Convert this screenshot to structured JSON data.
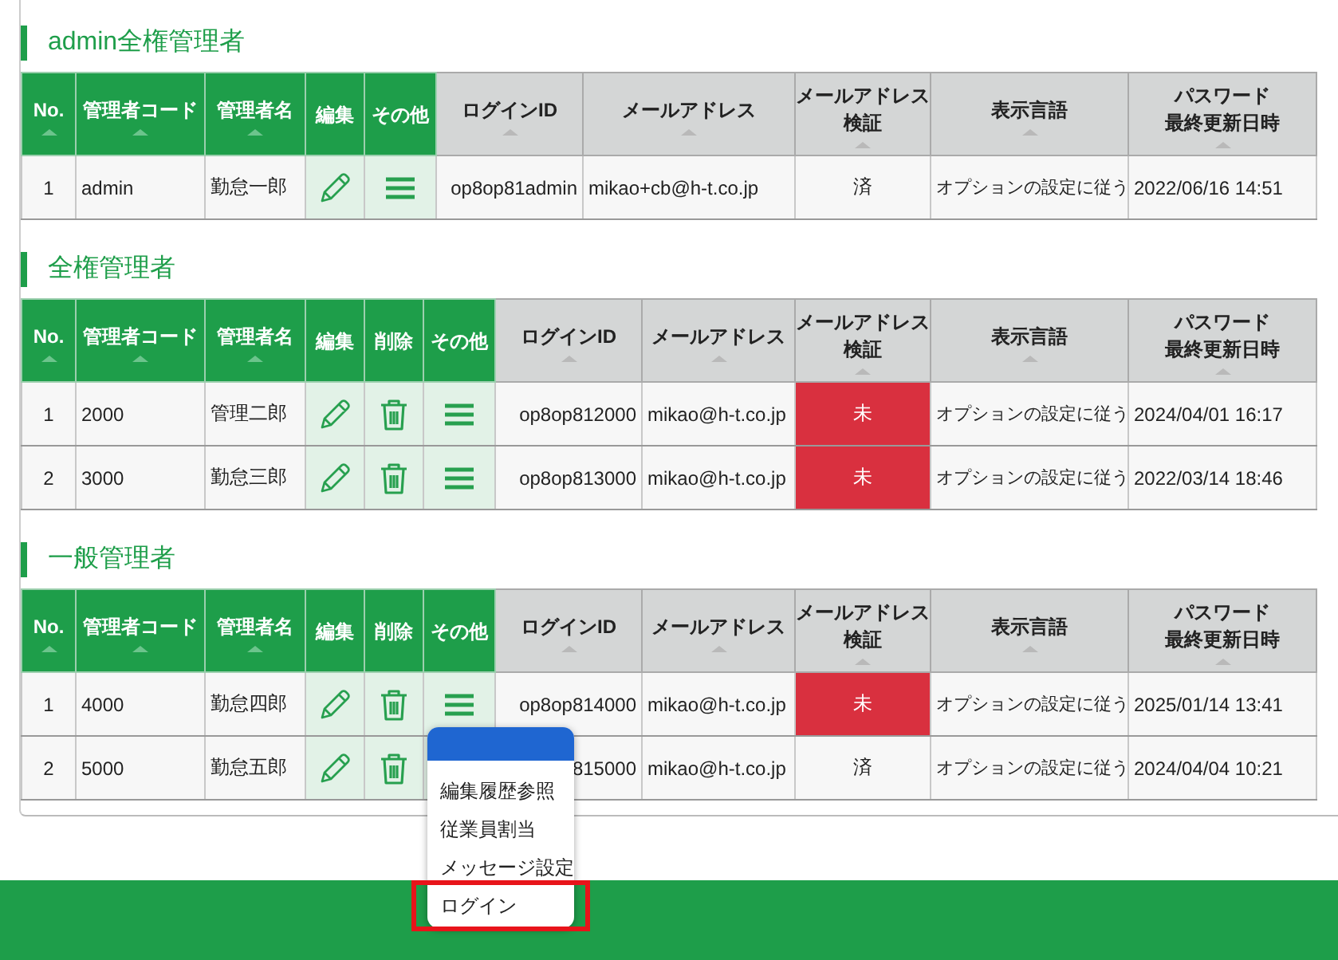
{
  "sections": [
    {
      "title": "admin全権管理者",
      "columns": [
        {
          "lines": [
            "No."
          ],
          "kind": "text",
          "sortable": true
        },
        {
          "lines": [
            "管理者コード"
          ],
          "kind": "text",
          "sortable": true
        },
        {
          "lines": [
            "管理者名"
          ],
          "kind": "text",
          "sortable": true
        },
        {
          "lines": [
            "編集"
          ],
          "kind": "edit",
          "sortable": false
        },
        {
          "lines": [
            "その他"
          ],
          "kind": "menu",
          "sortable": false
        },
        {
          "lines": [
            "ログインID"
          ],
          "kind": "text",
          "sortable": true
        },
        {
          "lines": [
            "メールアドレス"
          ],
          "kind": "text",
          "sortable": true
        },
        {
          "lines": [
            "メールアドレス",
            "検証"
          ],
          "kind": "verify",
          "sortable": true
        },
        {
          "lines": [
            "表示言語"
          ],
          "kind": "text",
          "sortable": true
        },
        {
          "lines": [
            "パスワード",
            "最終更新日時"
          ],
          "kind": "text",
          "sortable": true
        }
      ],
      "rows": [
        {
          "cells": [
            "1",
            "admin",
            "勤怠一郎",
            "",
            "",
            "op8op81admin",
            "mikao+cb@h-t.co.jp",
            "済",
            "オプションの設定に従う",
            "2022/06/16 14:51"
          ],
          "verified": true
        }
      ]
    },
    {
      "title": "全権管理者",
      "columns": [
        {
          "lines": [
            "No."
          ],
          "kind": "text",
          "sortable": true
        },
        {
          "lines": [
            "管理者コード"
          ],
          "kind": "text",
          "sortable": true
        },
        {
          "lines": [
            "管理者名"
          ],
          "kind": "text",
          "sortable": true
        },
        {
          "lines": [
            "編集"
          ],
          "kind": "edit",
          "sortable": false
        },
        {
          "lines": [
            "削除"
          ],
          "kind": "delete",
          "sortable": false
        },
        {
          "lines": [
            "その他"
          ],
          "kind": "menu",
          "sortable": false
        },
        {
          "lines": [
            "ログインID"
          ],
          "kind": "text",
          "sortable": true
        },
        {
          "lines": [
            "メールアドレス"
          ],
          "kind": "text",
          "sortable": true
        },
        {
          "lines": [
            "メールアドレス",
            "検証"
          ],
          "kind": "verify",
          "sortable": true
        },
        {
          "lines": [
            "表示言語"
          ],
          "kind": "text",
          "sortable": true
        },
        {
          "lines": [
            "パスワード",
            "最終更新日時"
          ],
          "kind": "text",
          "sortable": true
        }
      ],
      "rows": [
        {
          "cells": [
            "1",
            "2000",
            "管理二郎",
            "",
            "",
            "",
            "op8op812000",
            "mikao@h-t.co.jp",
            "未",
            "オプションの設定に従う",
            "2024/04/01 16:17"
          ],
          "verified": false
        },
        {
          "cells": [
            "2",
            "3000",
            "勤怠三郎",
            "",
            "",
            "",
            "op8op813000",
            "mikao@h-t.co.jp",
            "未",
            "オプションの設定に従う",
            "2022/03/14 18:46"
          ],
          "verified": false
        }
      ]
    },
    {
      "title": "一般管理者",
      "columns": [
        {
          "lines": [
            "No."
          ],
          "kind": "text",
          "sortable": true
        },
        {
          "lines": [
            "管理者コード"
          ],
          "kind": "text",
          "sortable": true
        },
        {
          "lines": [
            "管理者名"
          ],
          "kind": "text",
          "sortable": true
        },
        {
          "lines": [
            "編集"
          ],
          "kind": "edit",
          "sortable": false
        },
        {
          "lines": [
            "削除"
          ],
          "kind": "delete",
          "sortable": false
        },
        {
          "lines": [
            "その他"
          ],
          "kind": "menu",
          "sortable": false
        },
        {
          "lines": [
            "ログインID"
          ],
          "kind": "text",
          "sortable": true
        },
        {
          "lines": [
            "メールアドレス"
          ],
          "kind": "text",
          "sortable": true
        },
        {
          "lines": [
            "メールアドレス",
            "検証"
          ],
          "kind": "verify",
          "sortable": true
        },
        {
          "lines": [
            "表示言語"
          ],
          "kind": "text",
          "sortable": true
        },
        {
          "lines": [
            "パスワード",
            "最終更新日時"
          ],
          "kind": "text",
          "sortable": true
        }
      ],
      "rows": [
        {
          "cells": [
            "1",
            "4000",
            "勤怠四郎",
            "",
            "",
            "",
            "op8op814000",
            "mikao@h-t.co.jp",
            "未",
            "オプションの設定に従う",
            "2025/01/14 13:41"
          ],
          "verified": false,
          "menu": {
            "items": [
              {
                "label": "編集履歴参照",
                "highlighted": false
              },
              {
                "label": "従業員割当",
                "highlighted": false
              },
              {
                "label": "メッセージ設定",
                "highlighted": false
              },
              {
                "label": "ログイン",
                "highlighted": true
              }
            ]
          }
        },
        {
          "cells": [
            "2",
            "5000",
            "勤怠五郎",
            "",
            "",
            "",
            "815000",
            "mikao@h-t.co.jp",
            "済",
            "オプションの設定に従う",
            "2024/04/04 10:21"
          ],
          "verified": true
        }
      ]
    }
  ]
}
